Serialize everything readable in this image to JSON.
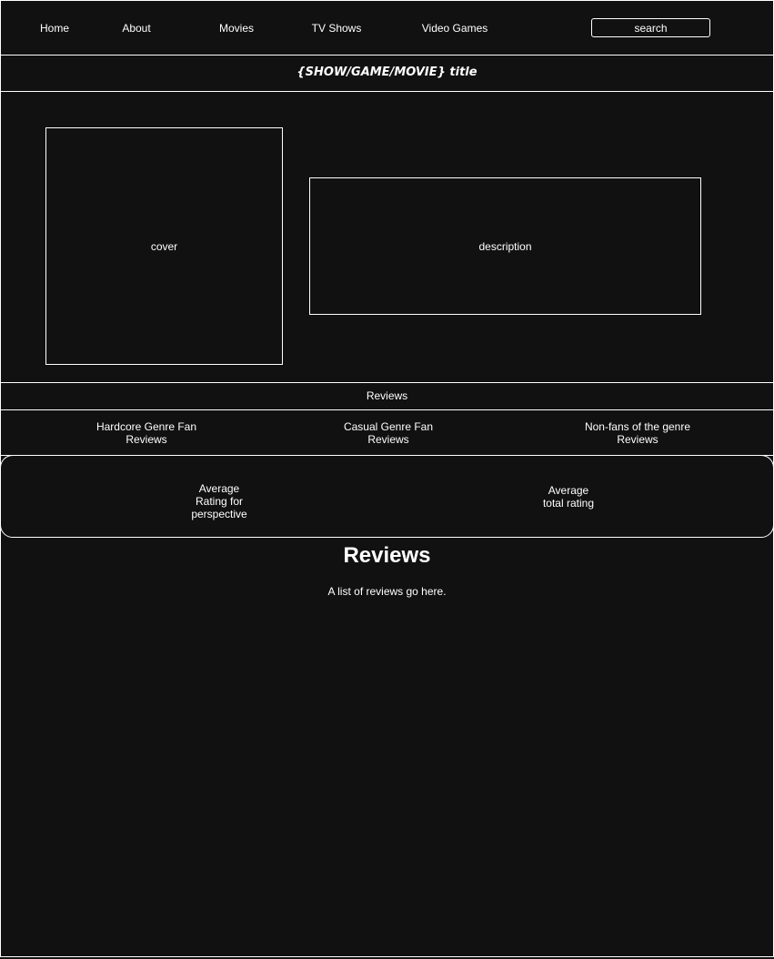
{
  "nav": {
    "items": [
      {
        "label": "Home"
      },
      {
        "label": "About"
      },
      {
        "label": "Movies"
      },
      {
        "label": "TV Shows"
      },
      {
        "label": "Video Games"
      }
    ],
    "search_placeholder": "search"
  },
  "title": "{SHOW/GAME/MOVIE} title",
  "cover_label": "cover",
  "description_label": "description",
  "reviews_tab_label": "Reviews",
  "perspectives": [
    {
      "line1": "Hardcore Genre Fan",
      "line2": "Reviews"
    },
    {
      "line1": "Casual Genre Fan",
      "line2": "Reviews"
    },
    {
      "line1": "Non-fans of the genre",
      "line2": "Reviews"
    }
  ],
  "ratings": {
    "perspective_lines": [
      "Average",
      "Rating for",
      "perspective"
    ],
    "total_lines": [
      "Average",
      "total rating"
    ]
  },
  "reviews": {
    "heading": "Reviews",
    "body": "A list of reviews go here."
  },
  "colors": {
    "background": "#111111",
    "foreground": "#ffffff"
  }
}
